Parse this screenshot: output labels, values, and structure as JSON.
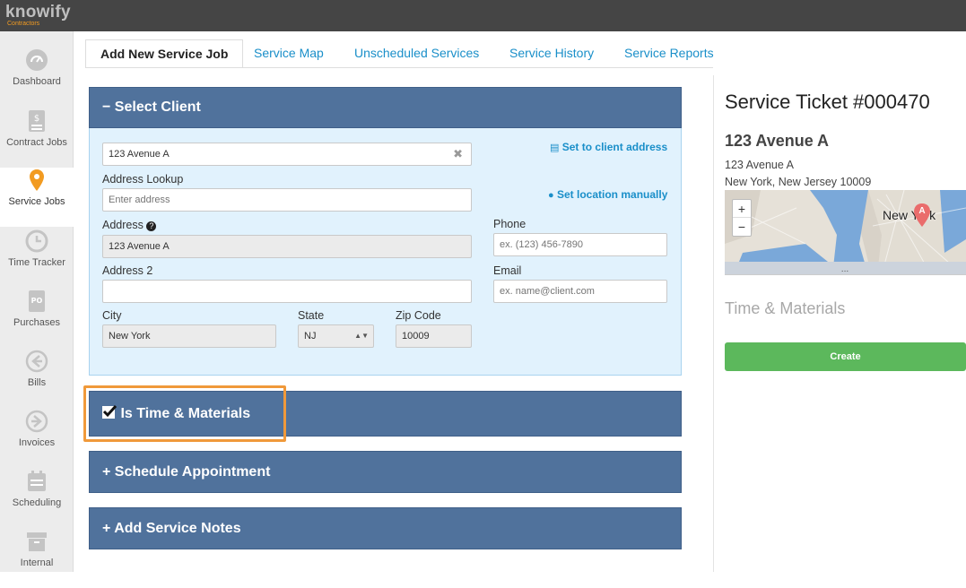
{
  "app": {
    "logo_word": "knowify",
    "logo_sub": "Contractors"
  },
  "sidebar": {
    "items": [
      {
        "label": "Dashboard",
        "icon": "dashboard-icon"
      },
      {
        "label": "Contract Jobs",
        "icon": "contract-icon"
      },
      {
        "label": "Service Jobs",
        "icon": "map-pin-icon",
        "active": true
      },
      {
        "label": "Time Tracker",
        "icon": "clock-icon"
      },
      {
        "label": "Purchases",
        "icon": "po-icon"
      },
      {
        "label": "Bills",
        "icon": "arrow-left-circle-icon"
      },
      {
        "label": "Invoices",
        "icon": "arrow-right-circle-icon"
      },
      {
        "label": "Scheduling",
        "icon": "calendar-icon"
      },
      {
        "label": "Internal",
        "icon": "archive-icon"
      }
    ]
  },
  "tabs": [
    {
      "label": "Add New Service Job",
      "active": true
    },
    {
      "label": "Service Map"
    },
    {
      "label": "Unscheduled Services"
    },
    {
      "label": "Service History"
    },
    {
      "label": "Service Reports"
    }
  ],
  "select_client": {
    "header": "Select Client",
    "client_value": "123 Avenue A",
    "set_client_address": "Set to client address",
    "set_location_manually": "Set location manually",
    "address_lookup": {
      "label": "Address Lookup",
      "placeholder": "Enter address"
    },
    "address": {
      "label": "Address",
      "value": "123 Avenue A"
    },
    "address2": {
      "label": "Address 2",
      "value": ""
    },
    "city": {
      "label": "City",
      "value": "New York"
    },
    "state": {
      "label": "State",
      "value": "NJ"
    },
    "zip": {
      "label": "Zip Code",
      "value": "10009"
    },
    "phone": {
      "label": "Phone",
      "placeholder": "ex. (123) 456-7890"
    },
    "email": {
      "label": "Email",
      "placeholder": "ex. name@client.com"
    }
  },
  "sections": {
    "time_materials": "Is Time & Materials",
    "schedule": "Schedule Appointment",
    "notes": "Add Service Notes"
  },
  "ticket": {
    "title": "Service Ticket #000470",
    "address_title": "123 Avenue A",
    "address_line1": "123 Avenue A",
    "address_line2": "New York, New Jersey 10009",
    "map_label": "New York",
    "map_marker": "A",
    "type_label": "Time & Materials",
    "create_button": "Create"
  },
  "colors": {
    "accent": "#1a8fc9",
    "panel_header": "#50729c",
    "highlight": "#f0993a",
    "create": "#5cb85c",
    "active_pin": "#f29b21"
  }
}
